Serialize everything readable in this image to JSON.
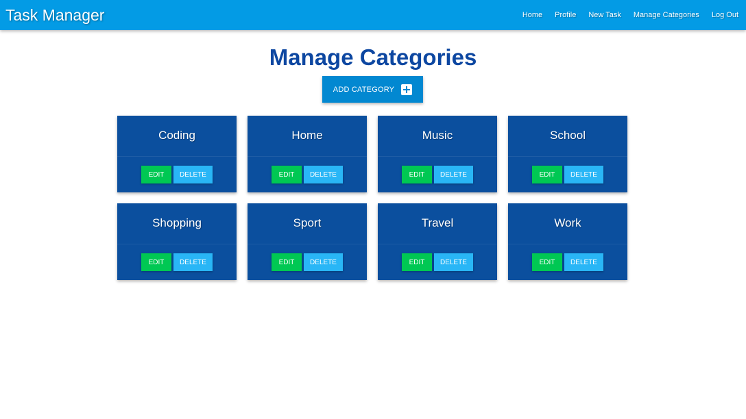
{
  "nav": {
    "brand": "Task Manager",
    "links": [
      "Home",
      "Profile",
      "New Task",
      "Manage Categories",
      "Log Out"
    ]
  },
  "page": {
    "title": "Manage Categories",
    "add_button_label": "ADD CATEGORY"
  },
  "categories": [
    {
      "name": "Coding",
      "edit_label": "EDIT",
      "delete_label": "DELETE"
    },
    {
      "name": "Home",
      "edit_label": "EDIT",
      "delete_label": "DELETE"
    },
    {
      "name": "Music",
      "edit_label": "EDIT",
      "delete_label": "DELETE"
    },
    {
      "name": "School",
      "edit_label": "EDIT",
      "delete_label": "DELETE"
    },
    {
      "name": "Shopping",
      "edit_label": "EDIT",
      "delete_label": "DELETE"
    },
    {
      "name": "Sport",
      "edit_label": "EDIT",
      "delete_label": "DELETE"
    },
    {
      "name": "Travel",
      "edit_label": "EDIT",
      "delete_label": "DELETE"
    },
    {
      "name": "Work",
      "edit_label": "EDIT",
      "delete_label": "DELETE"
    }
  ],
  "colors": {
    "navbar": "#039be5",
    "title": "#0d47a1",
    "card": "#0b4f9e",
    "edit": "#00c853",
    "delete": "#29b6f6",
    "add_button": "#0288d1"
  },
  "icons": {
    "add_button_icon": "plus-box-icon"
  }
}
